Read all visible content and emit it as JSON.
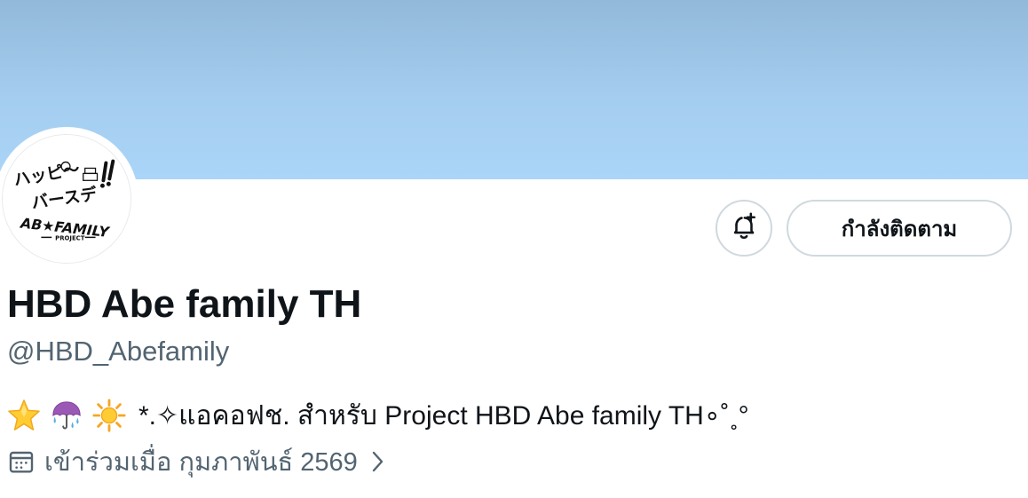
{
  "profile": {
    "display_name": "HBD Abe family TH",
    "handle": "@HBD_Abefamily",
    "bio_text": "*.✧แอคอฟช. สำหรับ Project HBD Abe family TH∘˚˳°",
    "joined_text": "เข้าร่วมเมื่อ กุมภาพันธ์ 2569"
  },
  "avatar": {
    "logo_line1": "ハッピ〜",
    "logo_line2": "バースデ",
    "logo_line3": "AB★FAMILY",
    "logo_sub": "PROJECT"
  },
  "actions": {
    "follow_label": "กำลังติดตาม",
    "bell_icon": "bell-plus-icon"
  },
  "icons": {
    "bio_emojis": [
      "star-emoji",
      "umbrella-rain-emoji",
      "sun-emoji"
    ],
    "joined": "calendar-icon",
    "more": "chevron-right-icon"
  },
  "colors": {
    "banner": "#a4cdef",
    "text_primary": "#0f1419",
    "text_secondary": "#536471",
    "border": "#cfd9de"
  }
}
